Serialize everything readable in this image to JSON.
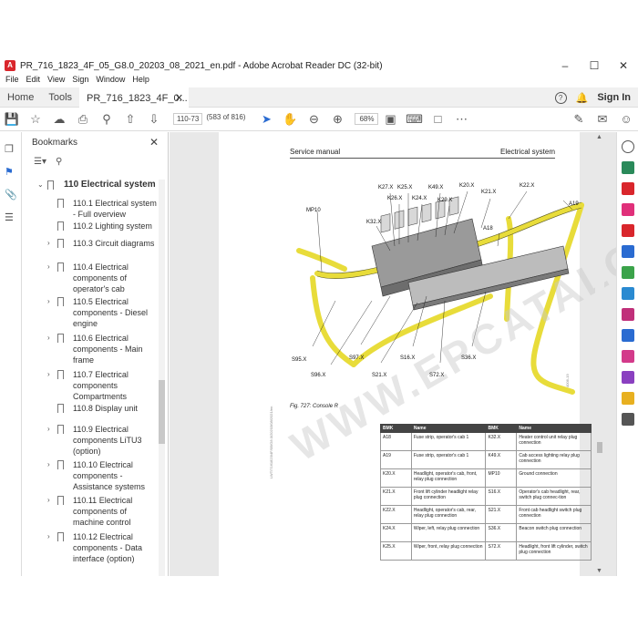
{
  "window": {
    "title": "PR_716_1823_4F_05_G8.0_20203_08_2021_en.pdf - Adobe Acrobat Reader DC (32-bit)",
    "minimize": "–",
    "maximize": "☐",
    "close": "✕"
  },
  "menu": [
    "File",
    "Edit",
    "View",
    "Sign",
    "Window",
    "Help"
  ],
  "tabs": {
    "home": "Home",
    "tools": "Tools",
    "doc": "PR_716_1823_4F_0...",
    "close": "✕",
    "signin": "Sign In"
  },
  "toolbar": {
    "page_current": "110-73",
    "page_total": "(583 of 816)",
    "zoom": "68%"
  },
  "bookmarks": {
    "title": "Bookmarks",
    "close": "✕",
    "items": [
      {
        "label": "110 Electrical system",
        "arrow": "⌄",
        "top": true
      },
      {
        "label": "110.1 Electrical system - Full overview",
        "arrow": ""
      },
      {
        "label": "110.2 Lighting system",
        "arrow": ""
      },
      {
        "label": "110.3 Circuit diagrams",
        "arrow": "›"
      },
      {
        "label": "110.4 Electrical components of operator's cab",
        "arrow": "›"
      },
      {
        "label": "110.5 Electrical components - Diesel engine",
        "arrow": "›"
      },
      {
        "label": "110.6 Electrical components - Main frame",
        "arrow": "›"
      },
      {
        "label": "110.7 Electrical components Compartments",
        "arrow": "›"
      },
      {
        "label": "110.8 Display unit",
        "arrow": ""
      },
      {
        "label": "110.9 Electrical components LiTU3 (option)",
        "arrow": "›"
      },
      {
        "label": "110.10 Electrical components - Assistance systems",
        "arrow": "›"
      },
      {
        "label": "110.11 Electrical components of machine control",
        "arrow": "›"
      },
      {
        "label": "110.12 Electrical components - Data interface (option)",
        "arrow": "›"
      }
    ]
  },
  "page": {
    "header_left": "Service manual",
    "header_right": "Electrical system",
    "caption": "Fig. 727: Console R",
    "labels": [
      "K27.X",
      "K25.X",
      "K49.X",
      "K20.X",
      "K22.X",
      "K26.X",
      "K24.X",
      "K29.X",
      "K21.X",
      "A19",
      "MP10",
      "K32.X",
      "A18",
      "S95.X",
      "S97.X",
      "S16.X",
      "S36.X",
      "S96.X",
      "S21.X",
      "S72.X"
    ],
    "watermark": "WWW.EPCATALOGS.COM",
    "table": {
      "headers": [
        "BMK",
        "Name",
        "BMK",
        "Name"
      ],
      "rows": [
        [
          "A18",
          "Fuse strip, operator's cab 1",
          "K32.X",
          "Heater control unit relay plug connection"
        ],
        [
          "A19",
          "Fuse strip, operator's cab 1",
          "K49.X",
          "Cab access lighting relay plug connection"
        ],
        [
          "K20.X",
          "Headlight, operator's cab, front, relay plug connection",
          "MP10",
          "Ground connection"
        ],
        [
          "K21.X",
          "Front lift cylinder headlight relay plug connection",
          "S16.X",
          "Operator's cab headlight, rear, switch plug connec-tion"
        ],
        [
          "K22.X",
          "Headlight, operator's cab, rear, relay plug connection",
          "S21.X",
          "Front cab headlight switch plug connection"
        ],
        [
          "K24.X",
          "Wiper, left, relay plug connection",
          "S36.X",
          "Beacon switch plug connection"
        ],
        [
          "K25.X",
          "Wiper, front, relay plug connection",
          "S72.X",
          "Headlight, front lift cylinder, switch plug connection"
        ]
      ]
    }
  },
  "colors": {
    "wire_yellow": "#e8dc3a",
    "acrobat_red": "#d9262c",
    "toolbar_blue": "#2a6bd1"
  }
}
